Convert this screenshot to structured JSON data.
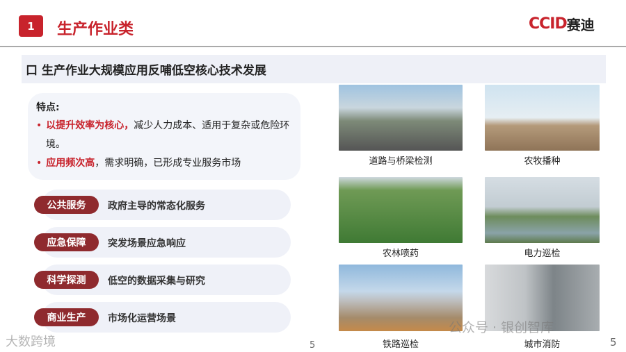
{
  "header": {
    "badge": "1",
    "title": "生产作业类",
    "logo_en": "CCID",
    "logo_cn": "赛迪"
  },
  "subhead": "口 生产作业大规模应用反哺低空核心技术发展",
  "features": {
    "heading": "特点:",
    "items": [
      {
        "highlight": "以提升效率为核心，",
        "text": "减少人力成本、适用于复杂或危险环境。"
      },
      {
        "highlight": "应用频次高",
        "text": "，需求明确，已形成专业服务市场"
      }
    ]
  },
  "categories": [
    {
      "label": "公共服务",
      "desc": "政府主导的常态化服务"
    },
    {
      "label": "应急保障",
      "desc": "突发场景应急响应"
    },
    {
      "label": "科学探测",
      "desc": "低空的数据采集与研究"
    },
    {
      "label": "商业生产",
      "desc": "市场化运营场景"
    }
  ],
  "images": [
    {
      "caption": "道路与桥梁检测"
    },
    {
      "caption": "农牧播种"
    },
    {
      "caption": "农林喷药"
    },
    {
      "caption": "电力巡检"
    },
    {
      "caption": "铁路巡检"
    },
    {
      "caption": "城市消防"
    }
  ],
  "page_number": "5",
  "page_number_right": "5",
  "watermarks": {
    "left": "大数跨境",
    "right": "公众号 · 银创智库"
  },
  "colors": {
    "accent": "#c8232c",
    "pill": "#8f2a2e"
  }
}
